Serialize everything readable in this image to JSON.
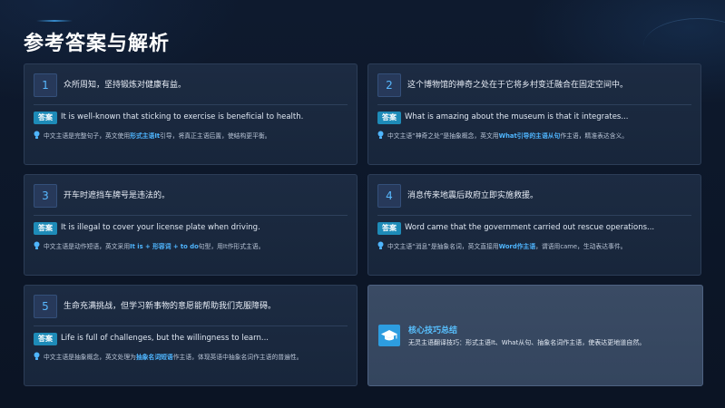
{
  "page": {
    "title": "参考答案与解析"
  },
  "answer_label": "答案",
  "cards": [
    {
      "num": "1",
      "question": "众所周知，坚持锻炼对健康有益。",
      "answer": "It is well-known that sticking to exercise is beneficial to health.",
      "note_pre": "中文主语是完整句子，英文使用",
      "note_hl": "形式主语It",
      "note_post": "引导，将真正主语后置，使结构更平衡。"
    },
    {
      "num": "2",
      "question": "这个博物馆的神奇之处在于它将乡村变迁融合在固定空间中。",
      "answer": "What is amazing about the museum is that it integrates...",
      "note_pre": "中文主语“神奇之处”是抽象概念，英文用",
      "note_hl": "What引导的主语从句",
      "note_post": "作主语，精准表达含义。"
    },
    {
      "num": "3",
      "question": "开车时遮挡车牌号是违法的。",
      "answer": "It is illegal to cover your license plate when driving.",
      "note_pre": "中文主语是动作短语，英文采用",
      "note_hl": "It is + 形容词 + to do",
      "note_post": "句型，用It作形式主语。"
    },
    {
      "num": "4",
      "question": "消息传来地震后政府立即实施救援。",
      "answer": "Word came that the government carried out rescue operations...",
      "note_pre": "中文主语“消息”是抽象名词，英文直接用",
      "note_hl": "Word作主语",
      "note_post": "，谓语用came，生动表达事件。"
    },
    {
      "num": "5",
      "question": "生命充满挑战，但学习新事物的意愿能帮助我们克服障碍。",
      "answer": "Life is full of challenges, but the willingness to learn...",
      "note_pre": "中文主语是抽象概念，英文处理为",
      "note_hl": "抽象名词短语",
      "note_post": "作主语，体现英语中抽象名词作主语的普遍性。"
    }
  ],
  "summary": {
    "title": "核心技巧总结",
    "text": "无灵主语翻译技巧：形式主语It、What从句、抽象名词作主语，使表达更地道自然。",
    "icon": "graduation-cap-icon"
  },
  "colors": {
    "accent": "#4fb6ff",
    "badge": "#1e8bb8",
    "background": "#0d1628",
    "card": "#1c2b42"
  }
}
